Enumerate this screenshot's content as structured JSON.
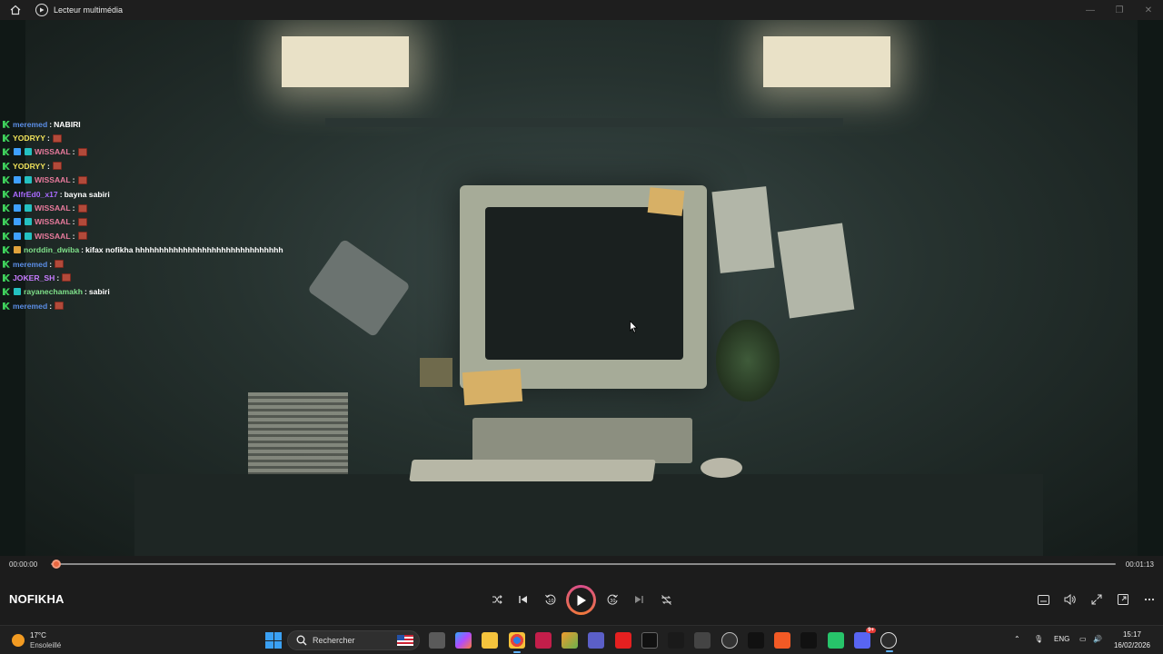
{
  "window": {
    "title": "Lecteur multimédia",
    "buttons": [
      "—",
      "❐",
      "✕"
    ]
  },
  "chat": [
    {
      "badges": [
        "k"
      ],
      "user": "meremed",
      "color": "c-blue",
      "message": "NABIRI",
      "emote": false
    },
    {
      "badges": [
        "k"
      ],
      "user": "YODRYY",
      "color": "c-yellow",
      "message": "",
      "emote": true
    },
    {
      "badges": [
        "k",
        "x",
        "t"
      ],
      "user": "WISSAAL",
      "color": "c-pink",
      "message": "",
      "emote": true
    },
    {
      "badges": [
        "k"
      ],
      "user": "YODRYY",
      "color": "c-yellow",
      "message": "",
      "emote": true
    },
    {
      "badges": [
        "k",
        "x",
        "t"
      ],
      "user": "WISSAAL",
      "color": "c-pink",
      "message": "",
      "emote": true
    },
    {
      "badges": [
        "k"
      ],
      "user": "AlfrEd0_x17",
      "color": "c-purple",
      "message": "bayna sabiri",
      "emote": false
    },
    {
      "badges": [
        "k",
        "x",
        "t"
      ],
      "user": "WISSAAL",
      "color": "c-pink",
      "message": "",
      "emote": true
    },
    {
      "badges": [
        "k",
        "x",
        "t"
      ],
      "user": "WISSAAL",
      "color": "c-pink",
      "message": "",
      "emote": true
    },
    {
      "badges": [
        "k",
        "x",
        "t"
      ],
      "user": "WISSAAL",
      "color": "c-pink",
      "message": "",
      "emote": true
    },
    {
      "badges": [
        "k",
        "g"
      ],
      "user": "norddin_dwiba",
      "color": "c-green",
      "message": "kifax nofikha hhhhhhhhhhhhhhhhhhhhhhhhhhhhhhh",
      "emote": false
    },
    {
      "badges": [
        "k"
      ],
      "user": "meremed",
      "color": "c-blue",
      "message": "",
      "emote": true
    },
    {
      "badges": [
        "k"
      ],
      "user": "JOKER_SH",
      "color": "c-lilac",
      "message": "",
      "emote": true
    },
    {
      "badges": [
        "k",
        "t"
      ],
      "user": "rayanechamakh",
      "color": "c-green",
      "message": "sabiri",
      "emote": false
    },
    {
      "badges": [
        "k"
      ],
      "user": "meremed",
      "color": "c-blue",
      "message": "",
      "emote": true
    }
  ],
  "player": {
    "current_time": "00:00:00",
    "total_time": "00:01:13",
    "progress": 0.0,
    "media_title": "NOFIKHA"
  },
  "taskbar": {
    "temperature": "17°C",
    "condition": "Ensoleillé",
    "search_placeholder": "Rechercher",
    "language": "ENG",
    "time": "15:17",
    "date": "16/02/2026",
    "discord_badge": "9+"
  },
  "colors": {
    "accent_play": "#e0567f",
    "seek_thumb": "#e8663f",
    "taskbar_bg": "#202020"
  }
}
